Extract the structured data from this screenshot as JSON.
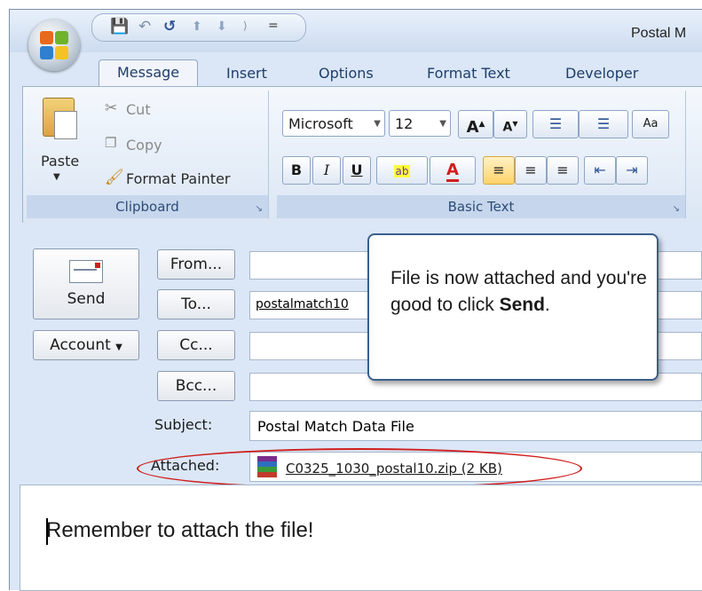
{
  "window": {
    "title": "Postal M"
  },
  "quick_access": {
    "customize": "="
  },
  "tabs": [
    "Message",
    "Insert",
    "Options",
    "Format Text",
    "Developer"
  ],
  "ribbon": {
    "clipboard": {
      "label": "Clipboard",
      "paste": "Paste",
      "cut": "Cut",
      "copy": "Copy",
      "format_painter": "Format Painter"
    },
    "basic_text": {
      "label": "Basic Text",
      "font_name": "Microsoft",
      "font_size": "12",
      "bold": "B",
      "italic": "I",
      "underline": "U",
      "grow_font": "A",
      "shrink_font": "A",
      "font_color": "A"
    }
  },
  "compose": {
    "send": "Send",
    "account": "Account",
    "from": "From...",
    "to": "To...",
    "cc": "Cc...",
    "bcc": "Bcc...",
    "to_value": "postalmatch10",
    "subject_label": "Subject:",
    "subject_value": "Postal Match Data File",
    "attached_label": "Attached:",
    "attachment": "C0325_1030_postal10.zip (2 KB)"
  },
  "body_text": "Remember to attach the file!",
  "callout": {
    "line1": "File is now attached and you're good to click",
    "bold": "Send",
    "end": "."
  },
  "colors": {
    "accent": "#1f3d6b",
    "highlight": "#d01e1e",
    "ribbon": "#dbe6f4"
  }
}
